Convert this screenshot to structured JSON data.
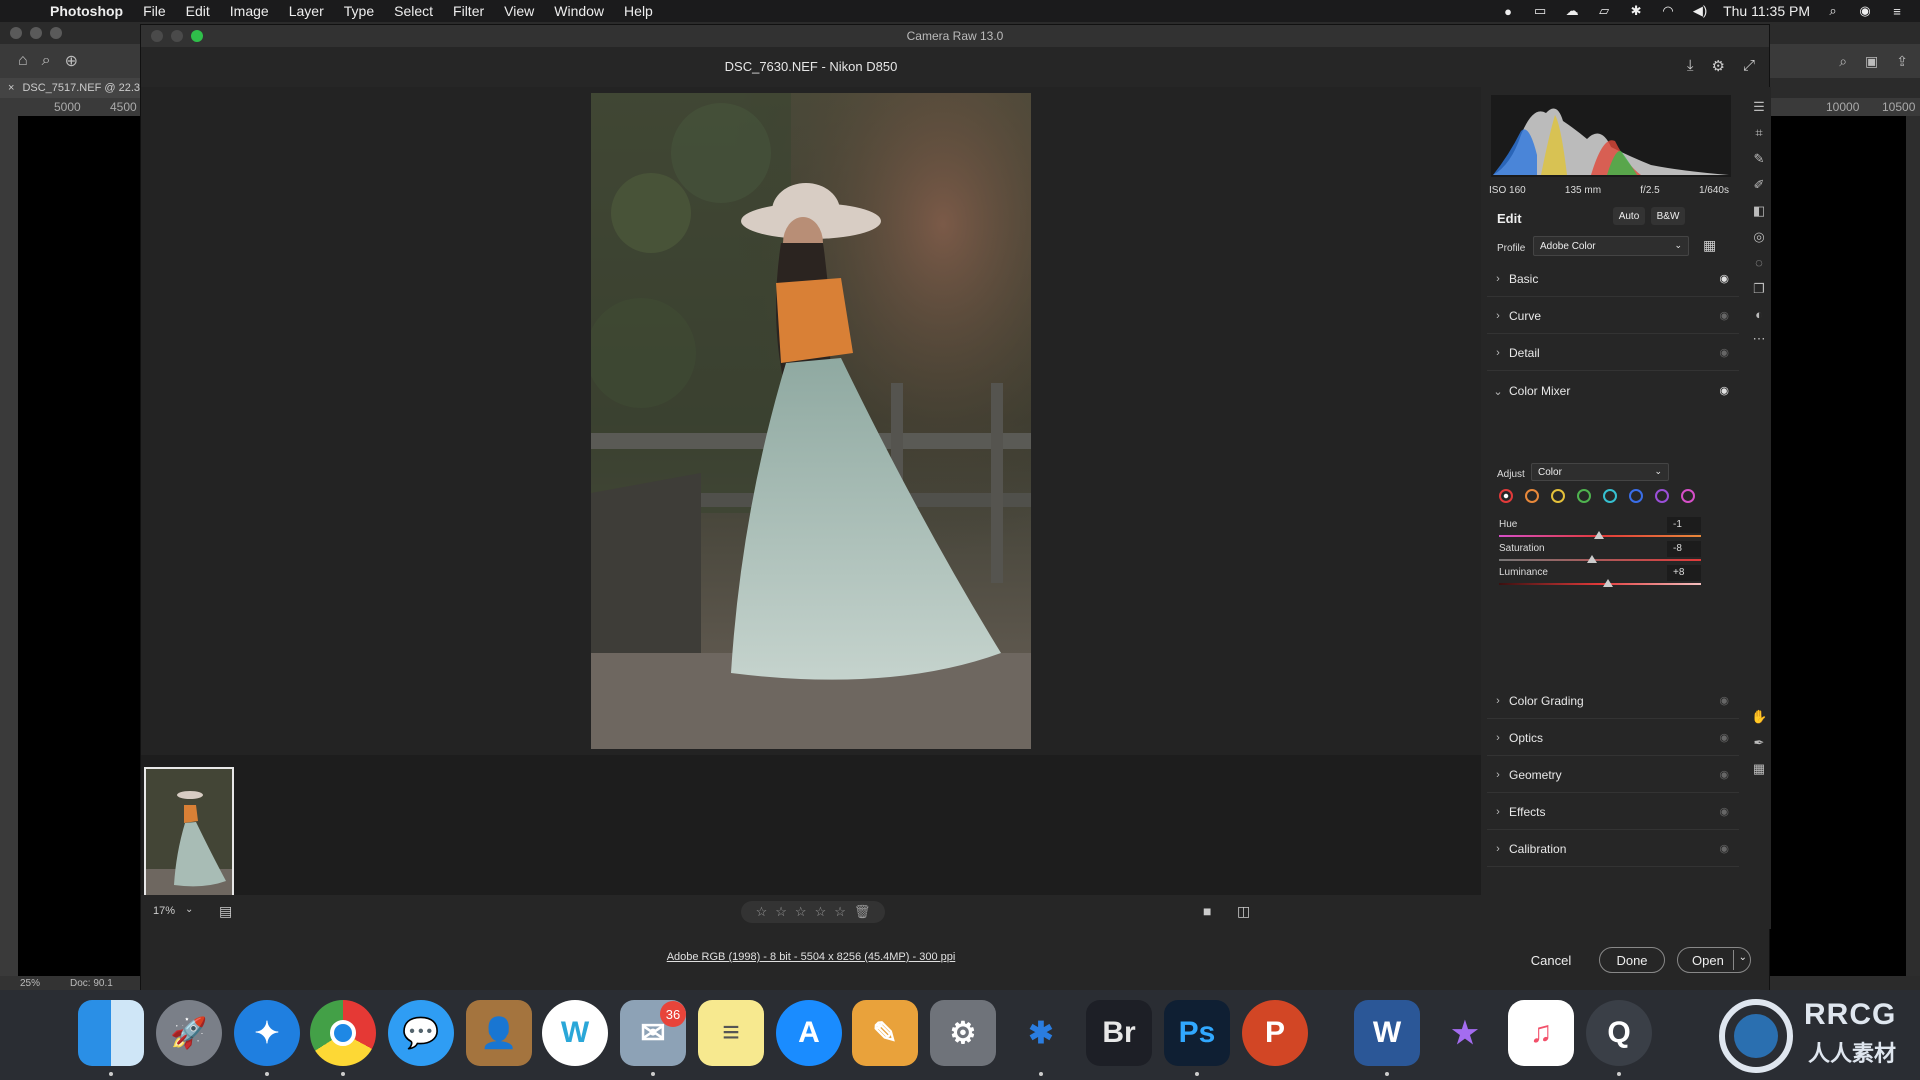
{
  "menubar": {
    "app_name": "Photoshop",
    "items": [
      "File",
      "Edit",
      "Image",
      "Layer",
      "Type",
      "Select",
      "Filter",
      "View",
      "Window",
      "Help"
    ],
    "clock": "Thu 11:35 PM"
  },
  "photoshop": {
    "doc_tab": "DSC_7517.NEF @ 22.3",
    "ruler_left_labels": [
      "5000",
      "4500"
    ],
    "ruler_right_labels": [
      "10000",
      "10500"
    ],
    "zoom_status": "25%",
    "doc_status": "Doc: 90.1"
  },
  "camera_raw": {
    "window_title": "Camera Raw 13.0",
    "file_title": "DSC_7630.NEF  -  Nikon D850",
    "zoom": "17%",
    "file_info": "Adobe RGB (1998) - 8 bit - 5504 x 8256 (45.4MP) - 300 ppi",
    "buttons": {
      "cancel": "Cancel",
      "done": "Done",
      "open": "Open"
    },
    "rating_stars": 0
  },
  "edit_panel": {
    "exif": {
      "iso": "ISO 160",
      "focal": "135 mm",
      "aperture": "f/2.5",
      "shutter": "1/640s"
    },
    "title": "Edit",
    "auto": "Auto",
    "bw": "B&W",
    "profile_label": "Profile",
    "profile_value": "Adobe Color",
    "sections_top": [
      {
        "label": "Basic",
        "visible": true
      },
      {
        "label": "Curve",
        "visible": false
      },
      {
        "label": "Detail",
        "visible": false
      }
    ],
    "color_mixer": {
      "label": "Color Mixer",
      "adjust_label": "Adjust",
      "adjust_value": "Color",
      "swatches": [
        "#e23a3a",
        "#e8883a",
        "#e3c03a",
        "#4fb34f",
        "#36c0d0",
        "#3a6ee8",
        "#9a4fd8",
        "#d64fc8"
      ],
      "sliders": [
        {
          "label": "Hue",
          "value": "-1",
          "level": -1
        },
        {
          "label": "Saturation",
          "value": "-8",
          "level": -8
        },
        {
          "label": "Luminance",
          "value": "+8",
          "level": 8
        }
      ]
    },
    "sections_bottom": [
      {
        "label": "Color Grading"
      },
      {
        "label": "Optics"
      },
      {
        "label": "Geometry"
      },
      {
        "label": "Effects"
      },
      {
        "label": "Calibration"
      }
    ]
  },
  "dock": {
    "mail_badge": "36",
    "apps": [
      "finder",
      "launchpad",
      "safari",
      "chrome",
      "messages",
      "contacts",
      "wunderlist",
      "mail",
      "notes",
      "app-store",
      "pages",
      "system-preferences",
      "bluetooth",
      "bridge",
      "photoshop",
      "powerpoint",
      "word",
      "imovie",
      "music",
      "quicktime"
    ],
    "labels": {
      "bridge": "Br",
      "photoshop": "Ps",
      "powerpoint": "P",
      "word": "W"
    }
  },
  "watermark": {
    "text": "RRCG",
    "subtext": "人人素材"
  }
}
